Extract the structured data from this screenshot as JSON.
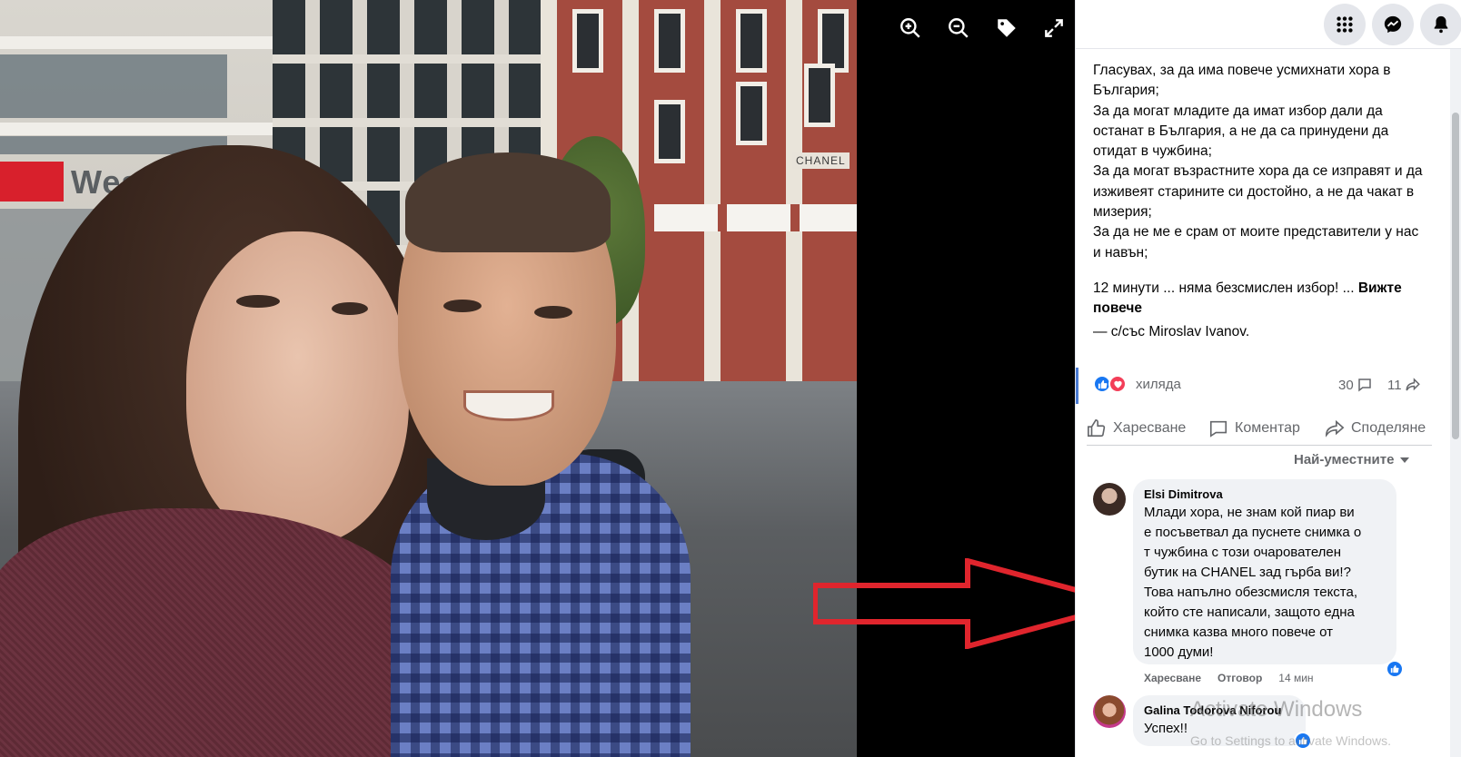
{
  "photo_viewer": {
    "tools": [
      {
        "icon": "zoom-in-icon"
      },
      {
        "icon": "zoom-out-icon"
      },
      {
        "icon": "tag-icon"
      },
      {
        "icon": "fullscreen-icon"
      }
    ],
    "background_signs": {
      "bank_sign": "Westpac",
      "shop_sign": "CHANEL"
    },
    "overlay_arrow_color": "#e0252d"
  },
  "topbar": {
    "buttons": [
      {
        "icon": "menu-grid-icon"
      },
      {
        "icon": "messenger-icon"
      },
      {
        "icon": "bell-icon"
      }
    ]
  },
  "post": {
    "text": "Гласувах, за да има повече усмихнати хора в България;\nЗа да могат младите да имат избор дали да останат в България, а не да са принудени да отидат в чужбина;\nЗа да могат възрастните хора да се изправят и да изживеят старините си достойно, а не да чакат в мизерия;\nЗа да не ме е срам от моите представители у нас и навън;",
    "more_line": "12 минути ... няма безсмислен избор! ...",
    "see_more": "Вижте повече",
    "tagged_prefix": "— с/със",
    "tagged_name": "Miroslav Ivanov."
  },
  "reactions": {
    "count_text": "хиляда",
    "comments": "30",
    "shares": "11"
  },
  "actions": {
    "like": "Харесване",
    "comment": "Коментар",
    "share": "Споделяне"
  },
  "sort": {
    "label": "Най-уместните"
  },
  "comments": [
    {
      "name": "Elsi Dimitrova",
      "text": "Млади хора, не знам кой пиар ви\nе посъветвал да пуснете снимка о\nт чужбина с този очарователен\nбутик на CHANEL зад гърба ви!?\nТова напълно обезсмисля текста,\nкойто сте написали, защото една\nснимка казва много повече от\n1000 думи!",
      "like_label": "Харесване",
      "reply_label": "Отговор",
      "time": "14 мин"
    },
    {
      "name": "Galina Todorova Niforou",
      "text": "Успех!!"
    }
  ],
  "watermark": {
    "title": "Activate Windows",
    "sub": "Go to Settings to activate Windows."
  },
  "colors": {
    "accent": "#1877f2",
    "love": "#f33e58",
    "secondary_text": "#65676b"
  }
}
